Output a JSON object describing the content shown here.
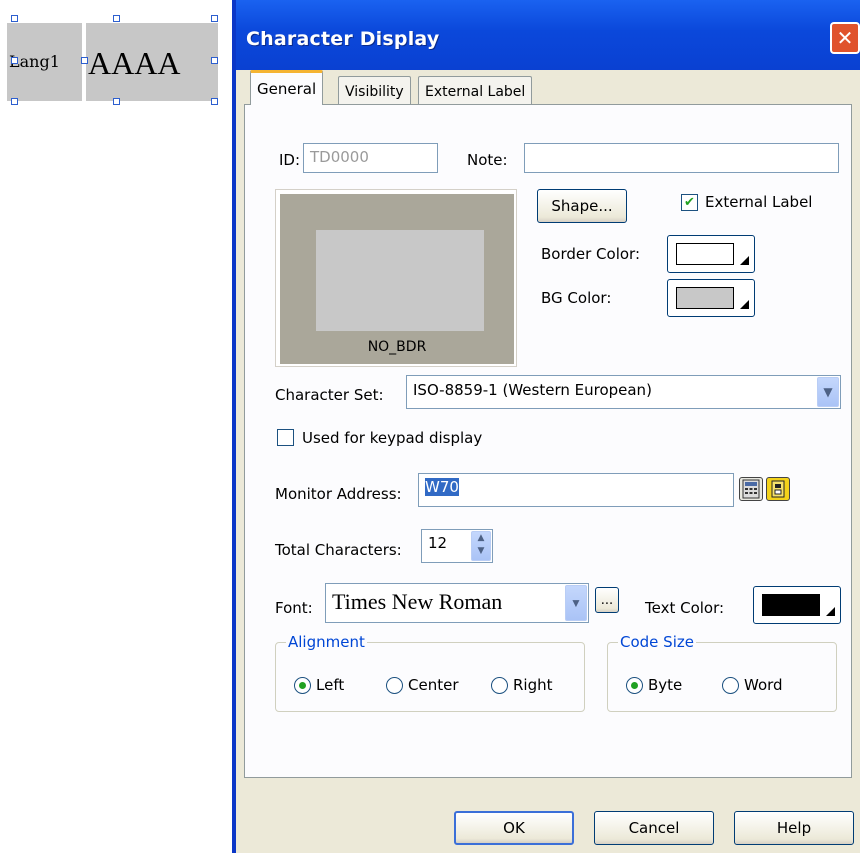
{
  "canvas": {
    "label_object_text": "Lang1",
    "char_object_text": "AAAA"
  },
  "dialog": {
    "title": "Character Display",
    "close_glyph": "✕",
    "tabs": [
      {
        "label": "General",
        "active": true
      },
      {
        "label": "Visibility",
        "active": false
      },
      {
        "label": "External Label",
        "active": false
      }
    ],
    "general": {
      "id_label": "ID:",
      "id_value": "TD0000",
      "note_label": "Note:",
      "note_value": "",
      "preview_caption": "NO_BDR",
      "shape_button": "Shape...",
      "external_label_checkbox": {
        "label": "External Label",
        "checked": true
      },
      "border_color_label": "Border Color:",
      "border_color": "#ffffff",
      "bg_color_label": "BG Color:",
      "bg_color": "#c8c8c8",
      "character_set_label": "Character Set:",
      "character_set_value": "ISO-8859-1 (Western European)",
      "keypad_checkbox": {
        "label": "Used for keypad display",
        "checked": false
      },
      "monitor_address_label": "Monitor Address:",
      "monitor_address_value": "W70",
      "total_characters_label": "Total Characters:",
      "total_characters_value": "12",
      "font_label": "Font:",
      "font_value": "Times New Roman",
      "font_more_button": "...",
      "text_color_label": "Text Color:",
      "text_color": "#000000",
      "alignment": {
        "title": "Alignment",
        "options": [
          "Left",
          "Center",
          "Right"
        ],
        "selected": "Left"
      },
      "code_size": {
        "title": "Code Size",
        "options": [
          "Byte",
          "Word"
        ],
        "selected": "Byte"
      }
    },
    "buttons": {
      "ok": "OK",
      "cancel": "Cancel",
      "help": "Help"
    }
  }
}
